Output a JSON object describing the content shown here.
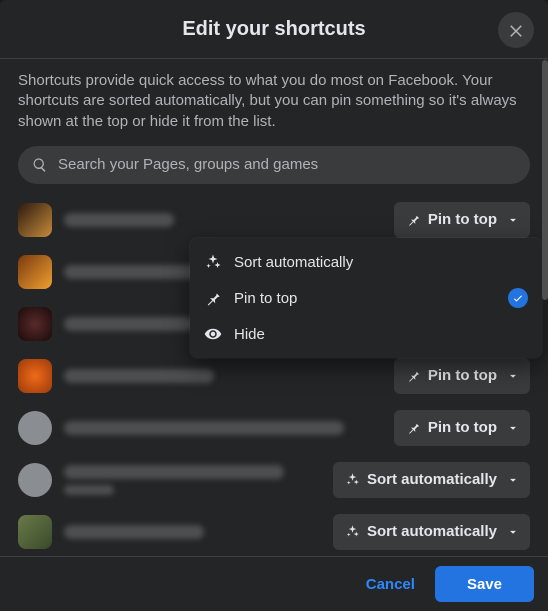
{
  "header": {
    "title": "Edit your shortcuts"
  },
  "subtext": "Shortcuts provide quick access to what you do most on Facebook. Your shortcuts are sorted automatically, but you can pin something so it's always shown at the top or hide it from the list.",
  "search": {
    "placeholder": "Search your Pages, groups and games"
  },
  "actions": {
    "pin": "Pin to top",
    "sort": "Sort automatically"
  },
  "menu": {
    "sort": "Sort automatically",
    "pin": "Pin to top",
    "hide": "Hide",
    "selected": "pin"
  },
  "items": [
    {
      "thumb_style": "background:linear-gradient(135deg,#2b1a0f,#c78a3a);",
      "thumb_shape": "sq",
      "name_w": 110,
      "action": "pin",
      "show_action": true
    },
    {
      "thumb_style": "background:linear-gradient(135deg,#7a3a0f,#f0a030);",
      "thumb_shape": "sq",
      "name_w": 140,
      "action": "pin",
      "show_action": false
    },
    {
      "thumb_style": "background:radial-gradient(circle,#5a2a2a,#1a0a0a);",
      "thumb_shape": "sq",
      "name_w": 130,
      "action": "pin",
      "show_action": false
    },
    {
      "thumb_style": "background:radial-gradient(circle,#f06a1a,#9a3a0a);",
      "thumb_shape": "sq",
      "name_w": 150,
      "action": "pin",
      "show_action": true
    },
    {
      "thumb_style": "background:#8a8d91;",
      "thumb_shape": "round",
      "name_w": 280,
      "action": "pin",
      "show_action": true
    },
    {
      "thumb_style": "background:#8a8d91;",
      "thumb_shape": "round",
      "name_w": 220,
      "sub_w": 50,
      "action": "sort",
      "show_action": true
    },
    {
      "thumb_style": "background:linear-gradient(135deg,#6a7a4a,#3a4a2a);",
      "thumb_shape": "sq",
      "name_w": 140,
      "action": "sort",
      "show_action": true
    }
  ],
  "footer": {
    "cancel": "Cancel",
    "save": "Save"
  }
}
